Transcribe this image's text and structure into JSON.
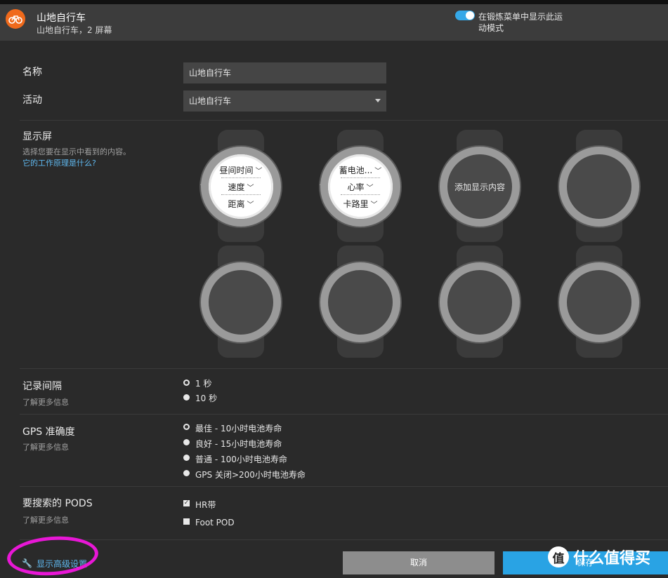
{
  "header": {
    "title": "山地自行车",
    "subtitle": "山地自行车，2 屏幕",
    "toggle_label": "在锻炼菜单中显示此运动模式",
    "toggle_on": true,
    "accent_color": "#f06a1c"
  },
  "form": {
    "name_label": "名称",
    "name_value": "山地自行车",
    "activity_label": "活动",
    "activity_value": "山地自行车"
  },
  "displays": {
    "label": "显示屏",
    "help": "选择您要在显示中看到的内容。",
    "link": "它的工作原理是什么?",
    "screen1": [
      "昼间时间",
      "速度",
      "距离"
    ],
    "screen2": [
      "蓄电池...",
      "心率",
      "卡路里"
    ],
    "add_text": "添加显示内容"
  },
  "recording": {
    "label": "记录间隔",
    "more": "了解更多信息",
    "options": [
      "1 秒",
      "10 秒"
    ],
    "selected": 0
  },
  "gps": {
    "label": "GPS 准确度",
    "more": "了解更多信息",
    "options": [
      "最佳 - 10小时电池寿命",
      "良好 - 15小时电池寿命",
      "普通 - 100小时电池寿命",
      "GPS 关闭>200小时电池寿命"
    ],
    "selected": 0
  },
  "pods": {
    "label": "要搜索的 PODS",
    "more": "了解更多信息",
    "options": [
      "HR带",
      "Foot POD"
    ],
    "checked": [
      true,
      false
    ]
  },
  "footer": {
    "advanced_link": "显示高级设置",
    "cancel": "取消",
    "save": "保存"
  },
  "watermark": {
    "badge": "值",
    "text": "什么值得买"
  },
  "colors": {
    "link": "#5fb8ef",
    "save": "#29a3e4",
    "annotation": "#e817d6"
  }
}
